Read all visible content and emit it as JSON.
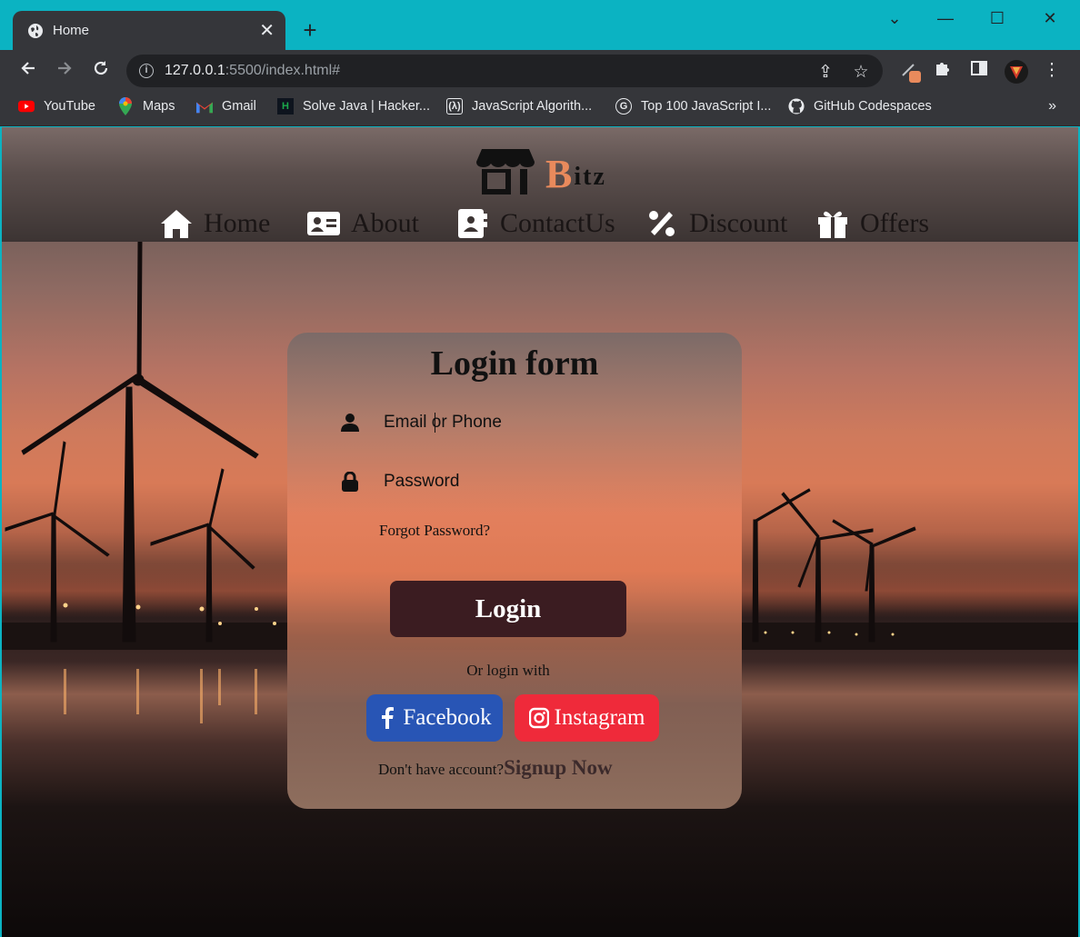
{
  "browser": {
    "tab_title": "Home",
    "tab_close": "✕",
    "new_tab": "+",
    "url_host": "127.0.0.1",
    "url_rest": ":5500/index.html#",
    "window_controls": [
      "⌄",
      "—",
      "☐",
      "✕"
    ],
    "bookmarks": [
      {
        "label": "YouTube",
        "icon": "youtube-icon"
      },
      {
        "label": "Maps",
        "icon": "maps-icon"
      },
      {
        "label": "Gmail",
        "icon": "gmail-icon"
      },
      {
        "label": "Solve Java | Hacker...",
        "icon": "hackerrank-icon"
      },
      {
        "label": "JavaScript Algorith...",
        "icon": "freecodecamp-icon"
      },
      {
        "label": "Top 100 JavaScript I...",
        "icon": "site-icon"
      },
      {
        "label": "GitHub Codespaces",
        "icon": "github-icon"
      }
    ],
    "bookmarks_more": "»"
  },
  "site": {
    "logo_first": "B",
    "logo_rest": "itz",
    "accent_color": "#e98a5c",
    "nav": [
      {
        "label": "Home",
        "icon": "home-icon"
      },
      {
        "label": "About",
        "icon": "id-card-icon"
      },
      {
        "label": "ContactUs",
        "icon": "contact-book-icon"
      },
      {
        "label": "Discount",
        "icon": "percent-icon"
      },
      {
        "label": "Offers",
        "icon": "gift-icon"
      }
    ]
  },
  "login": {
    "title": "Login form",
    "email_placeholder": "Email or Phone",
    "password_placeholder": "Password",
    "forgot": "Forgot Password?",
    "submit": "Login",
    "or_text": "Or login with",
    "facebook": "Facebook",
    "instagram": "Instagram",
    "no_account": "Don't have account?",
    "signup": "Signup Now",
    "colors": {
      "login_button": "#3b1c21",
      "facebook": "#2855b5",
      "instagram": "#ef2a3a"
    }
  }
}
